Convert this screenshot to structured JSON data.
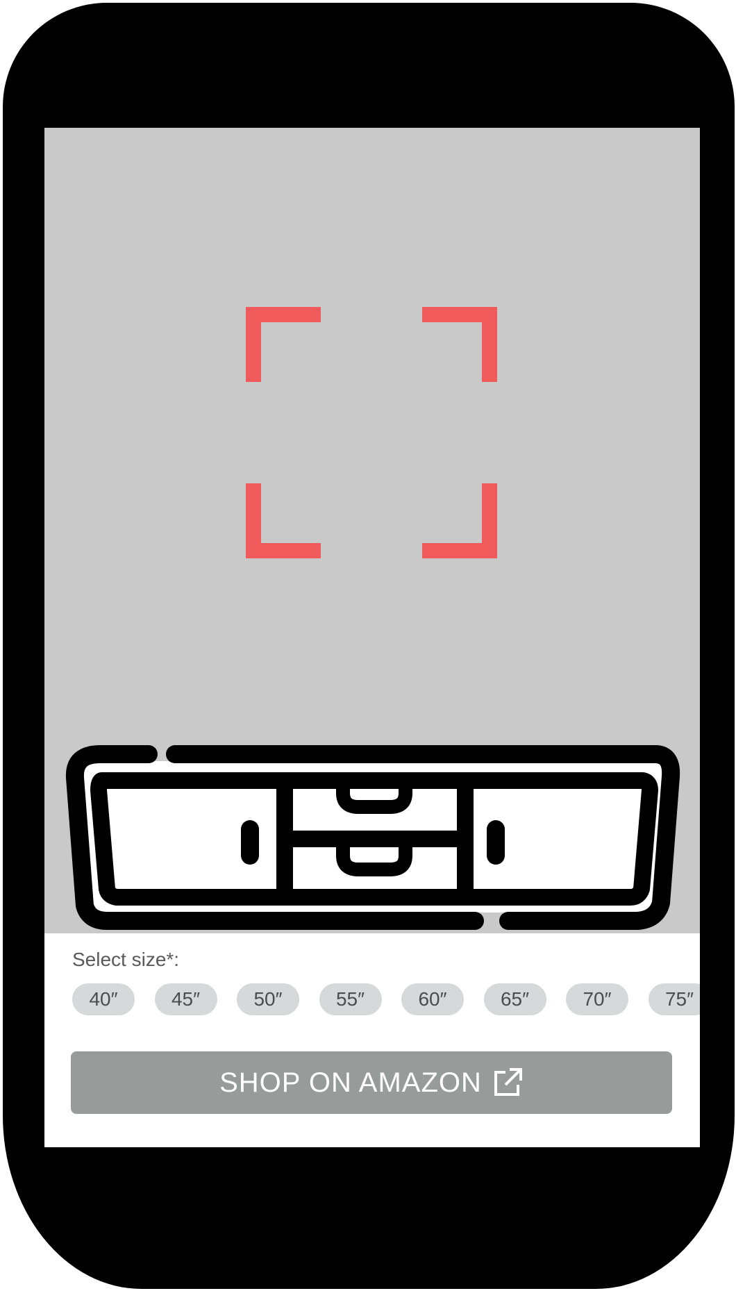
{
  "scanner": {
    "frame_color": "#f05a5a",
    "icon": "scan-frame-icon"
  },
  "product": {
    "icon": "tv-stand-icon"
  },
  "size_selector": {
    "label": "Select size*:",
    "options": [
      "40″",
      "45″",
      "50″",
      "55″",
      "60″",
      "65″",
      "70″",
      "75″"
    ]
  },
  "shop_button": {
    "label": "SHOP ON AMAZON",
    "icon": "external-link-icon",
    "color": "#979c9b"
  },
  "colors": {
    "camera_background": "#c9c9c9",
    "chip_background": "#d5d9d9"
  }
}
